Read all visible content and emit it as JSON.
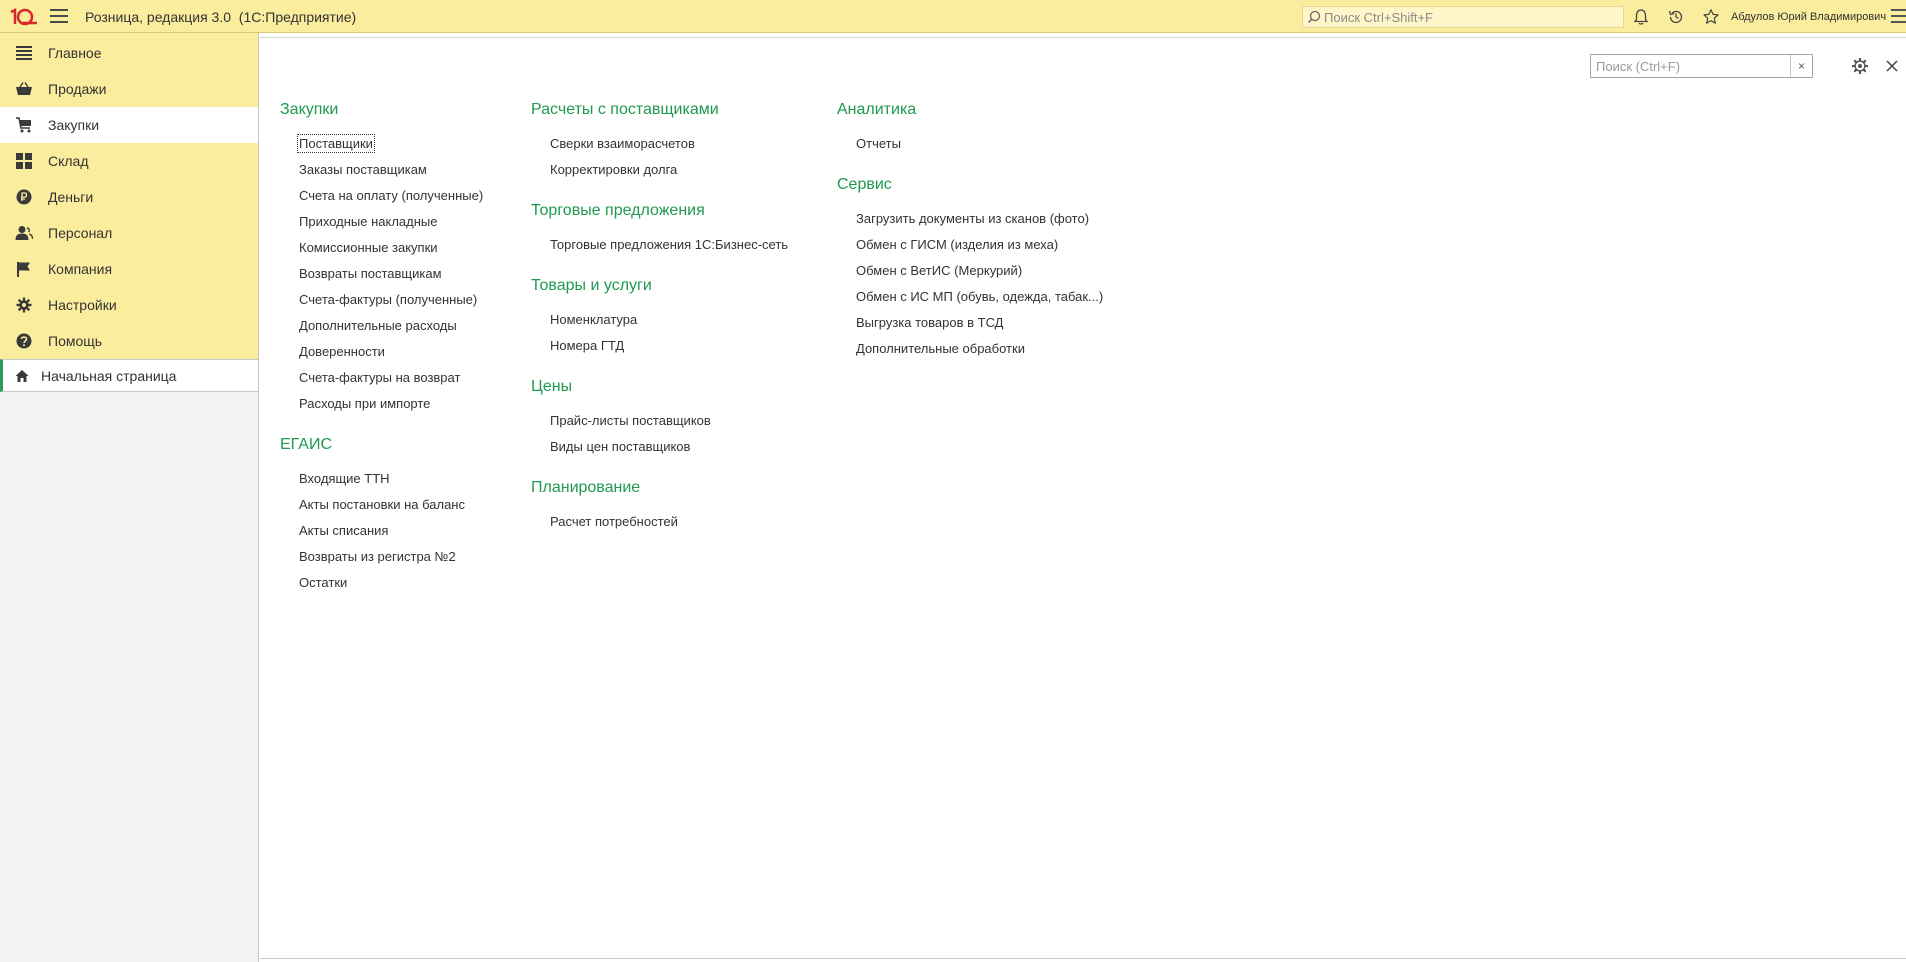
{
  "app": {
    "title": "Розница, редакция 3.0  (1С:Предприятие)",
    "logo_text": "1С",
    "search_placeholder": "Поиск Ctrl+Shift+F",
    "user": "Абдулов Юрий Владимирович"
  },
  "sidebar": {
    "items": [
      {
        "label": "Главное",
        "icon": "lines-icon"
      },
      {
        "label": "Продажи",
        "icon": "basket-icon"
      },
      {
        "label": "Закупки",
        "icon": "cart-icon"
      },
      {
        "label": "Склад",
        "icon": "grid-icon"
      },
      {
        "label": "Деньги",
        "icon": "ruble-icon"
      },
      {
        "label": "Персонал",
        "icon": "people-icon"
      },
      {
        "label": "Компания",
        "icon": "flag-icon"
      },
      {
        "label": "Настройки",
        "icon": "gear-icon"
      },
      {
        "label": "Помощь",
        "icon": "help-icon"
      }
    ],
    "active_index": 2,
    "home": "Начальная страница"
  },
  "main": {
    "search_placeholder": "Поиск (Ctrl+F)",
    "clear_symbol": "×",
    "columns": [
      {
        "sections": [
          {
            "title": "Закупки",
            "links": [
              "Поставщики",
              "Заказы поставщикам",
              "Счета на оплату (полученные)",
              "Приходные накладные",
              "Комиссионные закупки",
              "Возвраты поставщикам",
              "Счета-фактуры (полученные)",
              "Дополнительные расходы",
              "Доверенности",
              "Счета-фактуры на возврат",
              "Расходы при импорте"
            ]
          },
          {
            "title": "ЕГАИС",
            "links": [
              "Входящие ТТН",
              "Акты постановки на баланс",
              "Акты списания",
              "Возвраты из регистра №2",
              "Остатки"
            ]
          }
        ]
      },
      {
        "sections": [
          {
            "title": "Расчеты с поставщиками",
            "links": [
              "Сверки взаиморасчетов",
              "Корректировки долга"
            ]
          },
          {
            "title": "Торговые предложения",
            "links": [
              "Торговые предложения 1С:Бизнес-сеть"
            ]
          },
          {
            "title": "Товары и услуги",
            "links": [
              "Номенклатура",
              "Номера ГТД"
            ]
          },
          {
            "title": "Цены",
            "links": [
              "Прайс-листы поставщиков",
              "Виды цен поставщиков"
            ]
          },
          {
            "title": "Планирование",
            "links": [
              "Расчет потребностей"
            ]
          }
        ]
      },
      {
        "sections": [
          {
            "title": "Аналитика",
            "links": [
              "Отчеты"
            ]
          },
          {
            "title": "Сервис",
            "links": [
              "Загрузить документы из сканов (фото)",
              "Обмен с ГИСМ (изделия из меха)",
              "Обмен с ВетИС (Меркурий)",
              "Обмен с ИС МП (обувь, одежда, табак...)",
              "Выгрузка товаров в ТСД",
              "Дополнительные обработки"
            ]
          }
        ]
      }
    ]
  }
}
